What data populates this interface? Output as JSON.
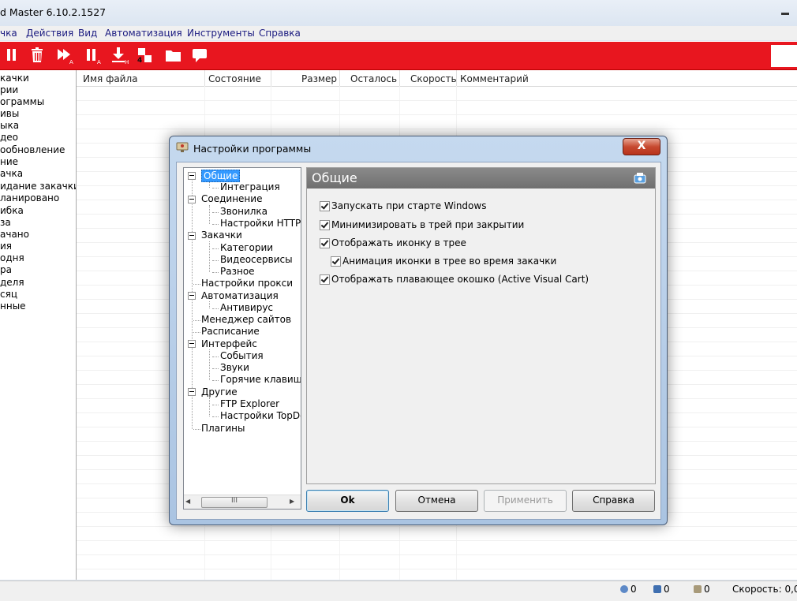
{
  "window": {
    "title": "d Master 6.10.2.1527"
  },
  "menu": [
    "чка",
    "Действия",
    "Вид",
    "Автоматизация",
    "Инструменты",
    "Справка"
  ],
  "toolbar": {
    "buttons": [
      "pause-icon",
      "trash-icon",
      "start-all-icon",
      "pause-all-icon",
      "download-icon",
      "tiles-icon",
      "folder-icon",
      "comment-icon"
    ],
    "sub_labels": {
      "start_all": "A",
      "pause_all": "A",
      "download": "H",
      "tiles": "4"
    }
  },
  "sidebar": {
    "items": [
      "качки",
      "рии",
      "ограммы",
      "ивы",
      "ыка",
      "део",
      "ообновление",
      "ние",
      "ачка",
      "идание закачки",
      "ланировано",
      "ибка",
      "за",
      "ачано",
      "ия",
      "одня",
      "ра",
      "деля",
      "сяц",
      "нные"
    ]
  },
  "filelist": {
    "columns": [
      "Имя файла",
      "Состояние",
      "Размер",
      "Осталось",
      "Скорость",
      "Комментарий"
    ]
  },
  "statusbar": {
    "counts": [
      "0",
      "0",
      "0"
    ],
    "speed": "Скорость: 0,0 |"
  },
  "dialog": {
    "title": "Настройки программы",
    "close": "X",
    "tree": [
      {
        "label": "Общие",
        "level": 0,
        "expanded": true,
        "selected": true
      },
      {
        "label": "Интеграция",
        "level": 1
      },
      {
        "label": "Соединение",
        "level": 0,
        "expanded": true
      },
      {
        "label": "Звонилка",
        "level": 1
      },
      {
        "label": "Настройки HTTP/F",
        "level": 1
      },
      {
        "label": "Закачки",
        "level": 0,
        "expanded": true
      },
      {
        "label": "Категории",
        "level": 1
      },
      {
        "label": "Видеосервисы",
        "level": 1
      },
      {
        "label": "Разное",
        "level": 1
      },
      {
        "label": "Настройки прокси",
        "level": 0
      },
      {
        "label": "Автоматизация",
        "level": 0,
        "expanded": true
      },
      {
        "label": "Антивирус",
        "level": 1
      },
      {
        "label": "Менеджер сайтов",
        "level": 0
      },
      {
        "label": "Расписание",
        "level": 0
      },
      {
        "label": "Интерфейс",
        "level": 0,
        "expanded": true
      },
      {
        "label": "События",
        "level": 1
      },
      {
        "label": "Звуки",
        "level": 1
      },
      {
        "label": "Горячие клавиши",
        "level": 1
      },
      {
        "label": "Другие",
        "level": 0,
        "expanded": true
      },
      {
        "label": "FTP Explorer",
        "level": 1
      },
      {
        "label": "Настройки TopDov",
        "level": 1
      },
      {
        "label": "Плагины",
        "level": 0
      }
    ],
    "scroll_grip": "III",
    "panel_title": "Общие",
    "options": [
      {
        "label": "Запускать при старте Windows",
        "checked": true,
        "indent": 0
      },
      {
        "label": "Минимизировать в трей при закрытии",
        "checked": true,
        "indent": 0
      },
      {
        "label": "Отображать иконку в трее",
        "checked": true,
        "indent": 0
      },
      {
        "label": "Анимация иконки в трее во время закачки",
        "checked": true,
        "indent": 1
      },
      {
        "label": "Отображать плавающее окошко (Active Visual Cart)",
        "checked": true,
        "indent": 0
      }
    ],
    "buttons": {
      "ok": "Ok",
      "cancel": "Отмена",
      "apply": "Применить",
      "help": "Справка"
    }
  }
}
